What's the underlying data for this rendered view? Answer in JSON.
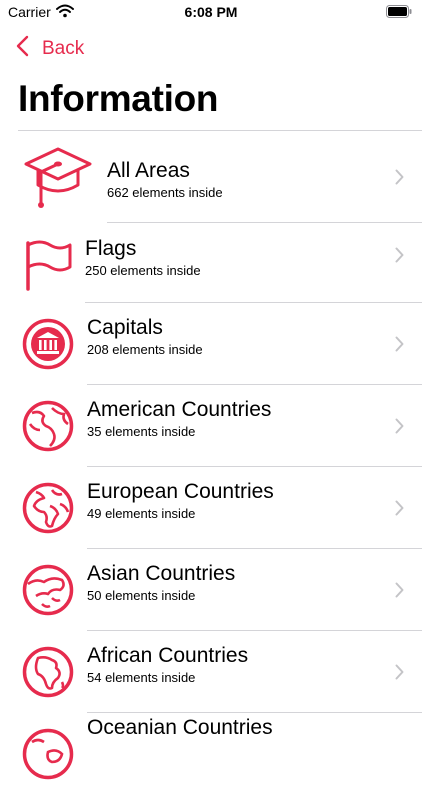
{
  "status_bar": {
    "carrier": "Carrier",
    "time": "6:08 PM"
  },
  "nav": {
    "back_label": "Back"
  },
  "page": {
    "title": "Information"
  },
  "accent_color": "#e62b4d",
  "rows": [
    {
      "icon": "graduation-cap-icon",
      "title": "All Areas",
      "subtitle": "662 elements inside"
    },
    {
      "icon": "flag-icon",
      "title": "Flags",
      "subtitle": "250 elements inside"
    },
    {
      "icon": "bank-building-icon",
      "title": "Capitals",
      "subtitle": "208 elements inside"
    },
    {
      "icon": "globe-americas-icon",
      "title": "American Countries",
      "subtitle": "35 elements inside"
    },
    {
      "icon": "globe-europe-africa-icon",
      "title": "European Countries",
      "subtitle": "49 elements inside"
    },
    {
      "icon": "globe-asia-icon",
      "title": "Asian Countries",
      "subtitle": "50 elements inside"
    },
    {
      "icon": "globe-africa-icon",
      "title": "African Countries",
      "subtitle": "54 elements inside"
    },
    {
      "icon": "globe-oceania-icon",
      "title": "Oceanian Countries",
      "subtitle": ""
    }
  ]
}
